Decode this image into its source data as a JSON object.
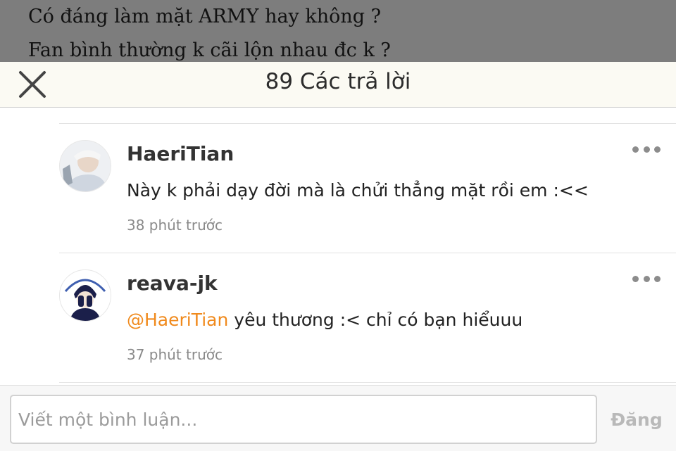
{
  "story": {
    "lines": [
      "Có đáng làm mặt ARMY hay không ?",
      "Fan bình thường k cãi lộn nhau đc k ?"
    ]
  },
  "header": {
    "title": "89 Các trả lời",
    "close_icon": "close-icon"
  },
  "replies": [
    {
      "username": "HaeriTian",
      "mention": "",
      "text": "Này k phải dạy đời mà là chửi thẳng mặt rồi em :<<",
      "time": "38 phút trước"
    },
    {
      "username": "reava-jk",
      "mention": "@HaeriTian",
      "text": " yêu thương :< chỉ có bạn hiểuuu",
      "time": "37 phút trước"
    }
  ],
  "composer": {
    "placeholder": "Viết một bình luận...",
    "post_label": "Đăng"
  },
  "colors": {
    "mention": "#f08a1d",
    "header_bg": "#fbfaf3",
    "backdrop": "#7d7d7d"
  }
}
